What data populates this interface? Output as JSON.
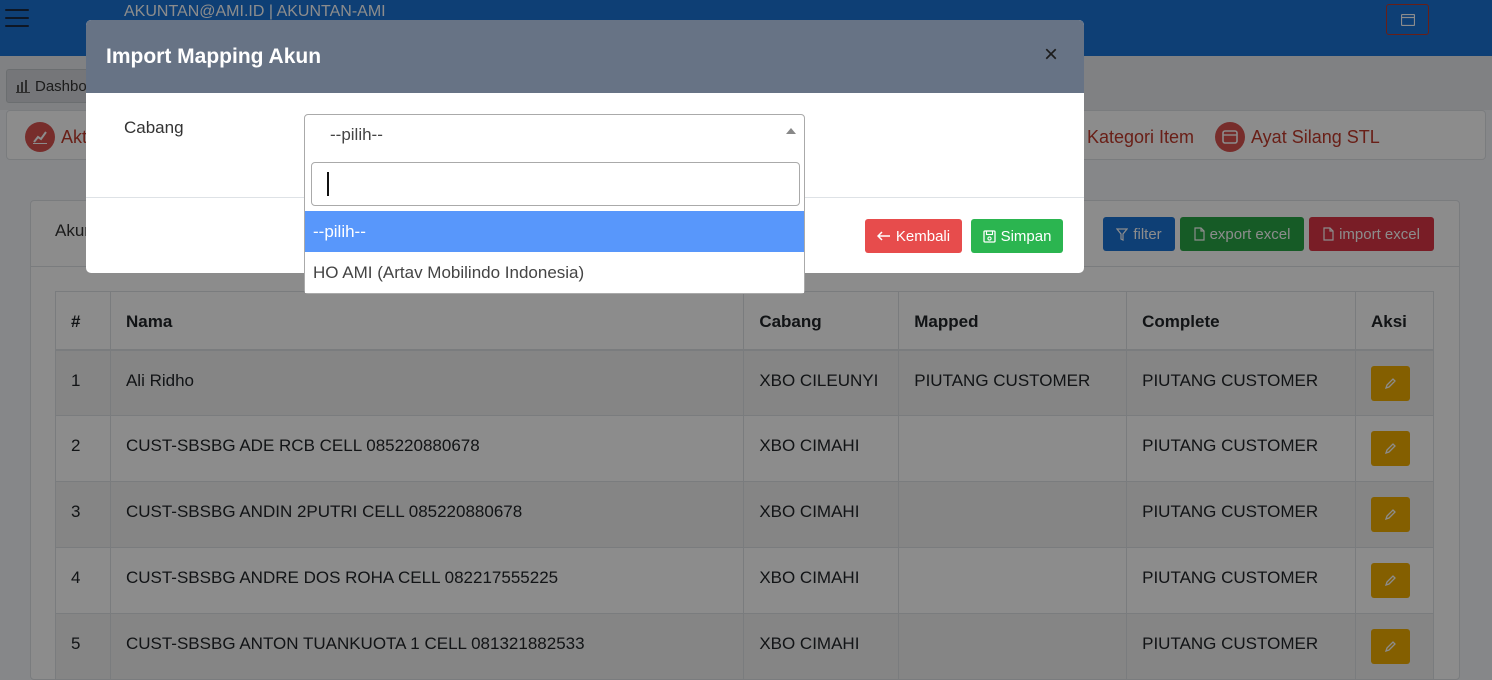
{
  "topbar": {
    "user_text": "AKUNTAN@AMI.ID | AKUNTAN-AMI"
  },
  "breadcrumb": {
    "dashboard_label": "Dashboard"
  },
  "menu": {
    "items": [
      {
        "label": "Aktiva",
        "icon": "chart-icon"
      },
      {
        "label": "Kategori Item",
        "icon": "box-icon"
      },
      {
        "label": "Ayat Silang STL",
        "icon": "box-icon"
      }
    ]
  },
  "list": {
    "title": "Akun",
    "filter_label": "filter",
    "export_label": "export excel",
    "import_label": "import excel",
    "columns": [
      "#",
      "Nama",
      "Cabang",
      "Mapped",
      "Complete",
      "Aksi"
    ],
    "rows": [
      {
        "no": "1",
        "nama": "Ali Ridho",
        "cabang": "XBO CILEUNYI",
        "mapped": "PIUTANG CUSTOMER",
        "complete": "PIUTANG CUSTOMER"
      },
      {
        "no": "2",
        "nama": "CUST-SBSBG ADE RCB CELL 085220880678",
        "cabang": "XBO CIMAHI",
        "mapped": "",
        "complete": "PIUTANG CUSTOMER"
      },
      {
        "no": "3",
        "nama": "CUST-SBSBG ANDIN 2PUTRI CELL 085220880678",
        "cabang": "XBO CIMAHI",
        "mapped": "",
        "complete": "PIUTANG CUSTOMER"
      },
      {
        "no": "4",
        "nama": "CUST-SBSBG ANDRE DOS ROHA CELL 082217555225",
        "cabang": "XBO CIMAHI",
        "mapped": "",
        "complete": "PIUTANG CUSTOMER"
      },
      {
        "no": "5",
        "nama": "CUST-SBSBG ANTON TUANKUOTA 1 CELL 081321882533",
        "cabang": "XBO CIMAHI",
        "mapped": "",
        "complete": "PIUTANG CUSTOMER"
      }
    ]
  },
  "modal": {
    "title": "Import Mapping Akun",
    "close_label": "×",
    "cabang_label": "Cabang",
    "select_value": "--pilih--",
    "search_value": "",
    "options": [
      "--pilih--",
      "HO AMI (Artav Mobilindo Indonesia)"
    ],
    "kembali_label": "Kembali",
    "simpan_label": "Simpan"
  },
  "colors": {
    "topbar": "#1a73d6",
    "modal_header": "#677385",
    "highlight_option": "#5897fb",
    "danger": "#dc3545",
    "success": "#28a745",
    "warning": "#f0ad00"
  }
}
